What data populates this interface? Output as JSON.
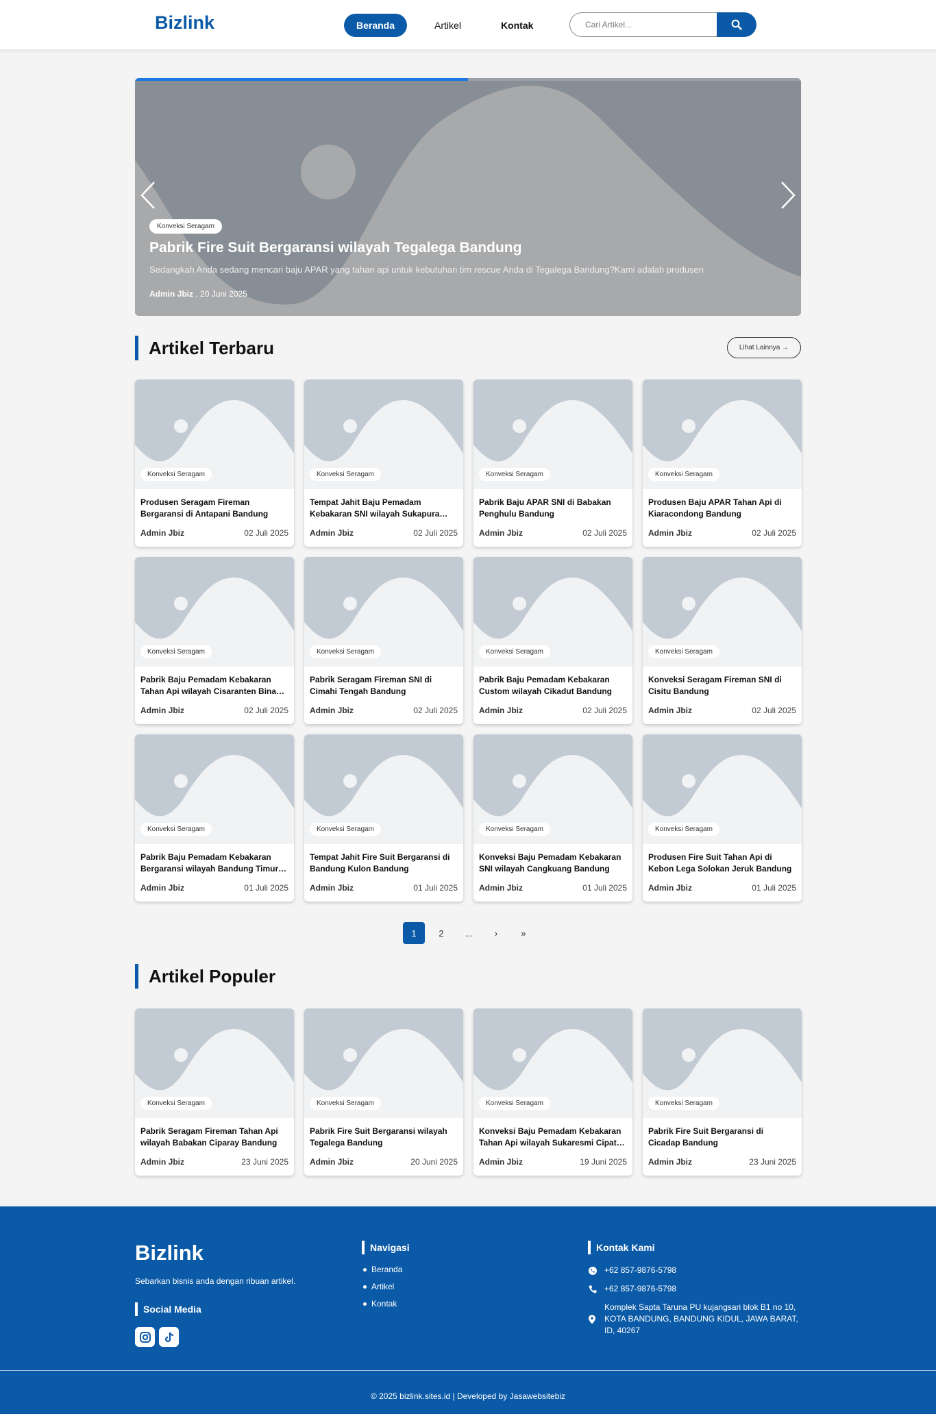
{
  "header": {
    "logo": "Bizlink",
    "nav": [
      {
        "label": "Beranda",
        "active": true
      },
      {
        "label": "Artikel",
        "active": false
      },
      {
        "label": "Kontak",
        "active": false
      }
    ],
    "search_placeholder": "Cari Artikel..."
  },
  "hero": {
    "progress_fraction": 0.5,
    "badge": "Konveksi Seragam",
    "title": "Pabrik Fire Suit Bergaransi wilayah Tegalega Bandung",
    "excerpt": "Sedangkah Anda sedang mencari baju APAR yang tahan api untuk kebutuhan tim rescue Anda di Tegalega Bandung?Kami adalah produsen",
    "author": "Admin Jbiz",
    "date": ", 20 Juni 2025"
  },
  "latest": {
    "title": "Artikel Terbaru",
    "more_label": "Lihat Lainnya →",
    "cards": [
      {
        "badge": "Konveksi Seragam",
        "title": "Produsen Seragam Fireman Bergaransi di Antapani Bandung",
        "author": "Admin Jbiz",
        "date": "02 Juli 2025"
      },
      {
        "badge": "Konveksi Seragam",
        "title": "Tempat Jahit Baju Pemadam Kebakaran SNI wilayah Sukapura Barat Bandung",
        "author": "Admin Jbiz",
        "date": "02 Juli 2025"
      },
      {
        "badge": "Konveksi Seragam",
        "title": "Pabrik Baju APAR SNI di Babakan Penghulu Bandung",
        "author": "Admin Jbiz",
        "date": "02 Juli 2025"
      },
      {
        "badge": "Konveksi Seragam",
        "title": "Produsen Baju APAR Tahan Api di Kiaracondong Bandung",
        "author": "Admin Jbiz",
        "date": "02 Juli 2025"
      },
      {
        "badge": "Konveksi Seragam",
        "title": "Pabrik Baju Pemadam Kebakaran Tahan Api wilayah Cisaranten Bina Harapan Bandung",
        "author": "Admin Jbiz",
        "date": "02 Juli 2025"
      },
      {
        "badge": "Konveksi Seragam",
        "title": "Pabrik Seragam Fireman SNI di Cimahi Tengah Bandung",
        "author": "Admin Jbiz",
        "date": "02 Juli 2025"
      },
      {
        "badge": "Konveksi Seragam",
        "title": "Pabrik Baju Pemadam Kebakaran Custom wilayah Cikadut Bandung",
        "author": "Admin Jbiz",
        "date": "02 Juli 2025"
      },
      {
        "badge": "Konveksi Seragam",
        "title": "Konveksi Seragam Fireman SNI di Cisitu Bandung",
        "author": "Admin Jbiz",
        "date": "02 Juli 2025"
      },
      {
        "badge": "Konveksi Seragam",
        "title": "Pabrik Baju Pemadam Kebakaran Bergaransi wilayah Bandung Timur Bandung",
        "author": "Admin Jbiz",
        "date": "01 Juli 2025"
      },
      {
        "badge": "Konveksi Seragam",
        "title": "Tempat Jahit Fire Suit Bergaransi di Bandung Kulon Bandung",
        "author": "Admin Jbiz",
        "date": "01 Juli 2025"
      },
      {
        "badge": "Konveksi Seragam",
        "title": "Konveksi Baju Pemadam Kebakaran SNI wilayah Cangkuang Bandung",
        "author": "Admin Jbiz",
        "date": "01 Juli 2025"
      },
      {
        "badge": "Konveksi Seragam",
        "title": "Produsen Fire Suit Tahan Api di Kebon Lega Solokan Jeruk Bandung",
        "author": "Admin Jbiz",
        "date": "01 Juli 2025"
      }
    ]
  },
  "pagination": [
    "1",
    "2",
    "...",
    "›",
    "»"
  ],
  "popular": {
    "title": "Artikel Populer",
    "cards": [
      {
        "badge": "Konveksi Seragam",
        "title": "Pabrik Seragam Fireman Tahan Api wilayah Babakan Ciparay Bandung",
        "author": "Admin Jbiz",
        "date": "23 Juni 2025"
      },
      {
        "badge": "Konveksi Seragam",
        "title": "Pabrik Fire Suit Bergaransi wilayah Tegalega Bandung",
        "author": "Admin Jbiz",
        "date": "20 Juni 2025"
      },
      {
        "badge": "Konveksi Seragam",
        "title": "Konveksi Baju Pemadam Kebakaran Tahan Api wilayah Sukaresmi Cipatat Bandung",
        "author": "Admin Jbiz",
        "date": "19 Juni 2025"
      },
      {
        "badge": "Konveksi Seragam",
        "title": "Pabrik Fire Suit Bergaransi di Cicadap Bandung",
        "author": "Admin Jbiz",
        "date": "23 Juni 2025"
      }
    ]
  },
  "footer": {
    "logo": "Bizlink",
    "tagline": "Sebarkan bisnis anda dengan ribuan artikel.",
    "social_heading": "Social Media",
    "social_icons": [
      "instagram-icon",
      "tiktok-icon"
    ],
    "nav_heading": "Navigasi",
    "nav_items": [
      "Beranda",
      "Artikel",
      "Kontak"
    ],
    "contact_heading": "Kontak Kami",
    "whatsapp": "+62 857-9876-5798",
    "phone": "+62 857-9876-5798",
    "address": "Komplek Sapta Taruna PU kujangsari blok B1 no 10, KOTA BANDUNG, BANDUNG KIDUL, JAWA BARAT, ID, 40267",
    "copyright": "© 2025 bizlink.sites.id | Developed by Jasawebsitebiz"
  },
  "colors": {
    "brand": "#0b5aa7",
    "hero_progress": "#1e78e3",
    "placeholder": "#c2cbd3",
    "background": "#f4f4f4"
  }
}
